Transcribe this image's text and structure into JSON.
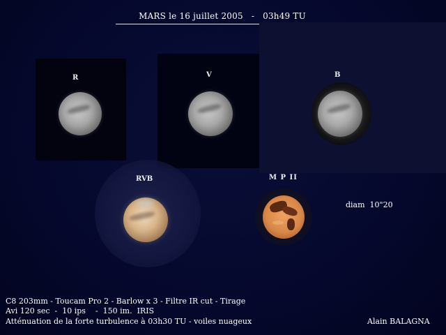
{
  "title": "MARS le 16 juillet 2005   -   03h49 TU",
  "images": {
    "r_label": "R",
    "v_label": "V",
    "b_label": "B",
    "rvb_label": "RVB",
    "mp_label": "M P II"
  },
  "diameter": "diam  10\"20",
  "captions": {
    "line1": "C8 203mm - Toucam Pro 2 - Barlow x 3 - Filtre IR cut - Tirage",
    "line2": "Avi 120 sec  -  10 ips    -  150 im.  IRIS",
    "line3": "Atténuation de la forte turbulence à 03h30 TU - voiles nuageux"
  },
  "author": "Alain BALAGNA",
  "colors": {
    "background": "#03062a",
    "text": "#ffffff",
    "mars_map": "#d88848"
  }
}
